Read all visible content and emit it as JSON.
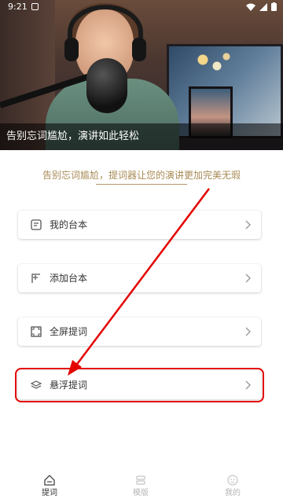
{
  "status_bar": {
    "time": "9:21"
  },
  "hero": {
    "caption": "告别忘词尴尬，演讲如此轻松"
  },
  "tagline": "告别忘词尴尬，提词器让您的演讲更加完美无瑕",
  "menu": [
    {
      "label": "我的台本",
      "icon": "script-icon"
    },
    {
      "label": "添加台本",
      "icon": "add-script-icon"
    },
    {
      "label": "全屏提词",
      "icon": "fullscreen-icon"
    },
    {
      "label": "悬浮提词",
      "icon": "layers-icon",
      "highlighted": true
    }
  ],
  "annotation_color": "#e30000",
  "accent_color": "#a88a55",
  "nav": [
    {
      "label": "提词",
      "icon": "prompt-icon",
      "active": true
    },
    {
      "label": "模版",
      "icon": "template-icon",
      "active": false
    },
    {
      "label": "我的",
      "icon": "profile-icon",
      "active": false
    }
  ]
}
